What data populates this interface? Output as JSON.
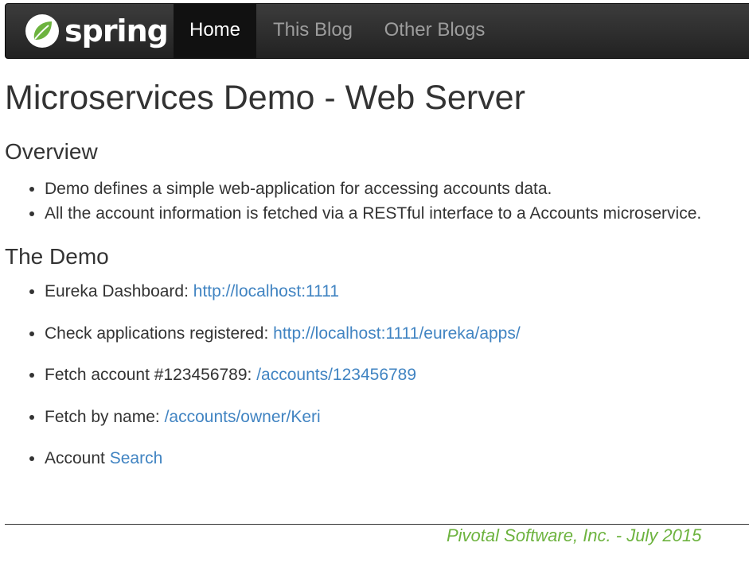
{
  "nav": {
    "brand": "spring",
    "items": [
      {
        "label": "Home",
        "active": true
      },
      {
        "label": "This Blog",
        "active": false
      },
      {
        "label": "Other Blogs",
        "active": false
      }
    ]
  },
  "page": {
    "title": "Microservices Demo - Web Server",
    "overview": {
      "heading": "Overview",
      "items": [
        "Demo defines a simple web-application for accessing accounts data.",
        "All the account information is fetched via a RESTful interface to a Accounts microservice."
      ]
    },
    "demo": {
      "heading": "The Demo",
      "items": [
        {
          "text": "Eureka Dashboard: ",
          "link": "http://localhost:1111"
        },
        {
          "text": "Check applications registered: ",
          "link": "http://localhost:1111/eureka/apps/"
        },
        {
          "text": "Fetch account #123456789: ",
          "link": "/accounts/123456789"
        },
        {
          "text": "Fetch by name: ",
          "link": "/accounts/owner/Keri"
        },
        {
          "text": "Account ",
          "link": "Search"
        }
      ]
    }
  },
  "footer": {
    "text": "Pivotal Software, Inc. - July 2015"
  },
  "colors": {
    "link": "#4184c2",
    "footer": "#6db33f",
    "brand_leaf": "#6db33f"
  }
}
